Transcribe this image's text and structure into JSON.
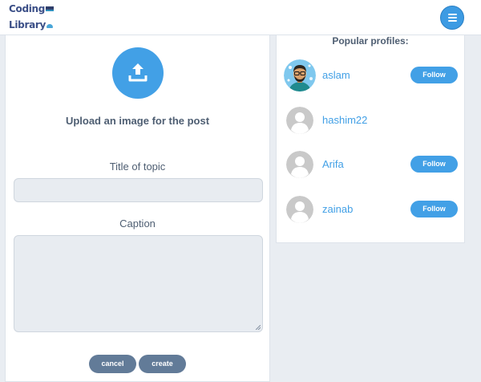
{
  "header": {
    "logo_line1": "Coding",
    "logo_line2": "Library",
    "menu_icon": "hamburger-menu-icon"
  },
  "post_form": {
    "upload_icon": "upload-icon",
    "upload_label": "Upload an image for the post",
    "title_label": "Title of topic",
    "title_value": "",
    "caption_label": "Caption",
    "caption_value": "",
    "cancel_label": "cancel",
    "create_label": "create"
  },
  "popular_profiles": {
    "title": "Popular profiles:",
    "profiles": [
      {
        "name": "aslam",
        "follow_label": "Follow",
        "avatar": "cartoon-avatar-icon"
      },
      {
        "name": "hashim22",
        "avatar": "default-avatar-icon"
      },
      {
        "name": "Arifa",
        "follow_label": "Follow",
        "avatar": "default-avatar-icon"
      },
      {
        "name": "zainab",
        "follow_label": "Follow",
        "avatar": "default-avatar-icon"
      }
    ]
  },
  "colors": {
    "accent": "#42a0e6",
    "button_dark": "#627b98",
    "text": "#4e5e72",
    "background": "#e9edf2"
  }
}
